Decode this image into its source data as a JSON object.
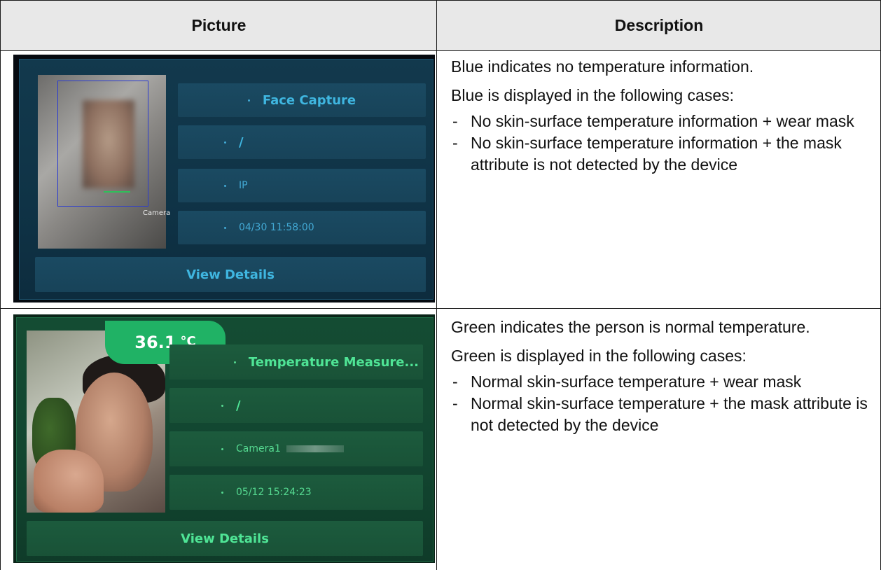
{
  "table": {
    "headers": {
      "picture": "Picture",
      "description": "Description"
    }
  },
  "rows": [
    {
      "card": {
        "theme": "blue",
        "title": "Face Capture",
        "field2": "/",
        "field3": "IP",
        "time": "04/30 11:58:00",
        "photo_label": "Camera",
        "button": "View Details"
      },
      "description": {
        "intro": "Blue indicates no temperature information.",
        "cases_heading": "Blue is displayed in the following cases:",
        "cases": [
          "No skin-surface temperature information + wear mask",
          "No skin-surface temperature information + the mask attribute is not detected by the device"
        ]
      }
    },
    {
      "card": {
        "theme": "green",
        "temperature": "36.1",
        "temperature_unit": "°C",
        "title": "Temperature Measure...",
        "field2": "/",
        "field3": "Camera1",
        "time": "05/12 15:24:23",
        "button": "View Details"
      },
      "description": {
        "intro": "Green indicates the person is normal temperature.",
        "cases_heading": "Green is displayed in the following cases:",
        "cases": [
          "Normal skin-surface temperature + wear mask",
          "Normal skin-surface temperature + the mask attribute is not detected by the device"
        ]
      }
    }
  ],
  "colors": {
    "header_bg": "#e8e8e8",
    "blue_accent": "#3fb6e0",
    "green_accent": "#4fe596",
    "green_badge": "#20b265"
  }
}
